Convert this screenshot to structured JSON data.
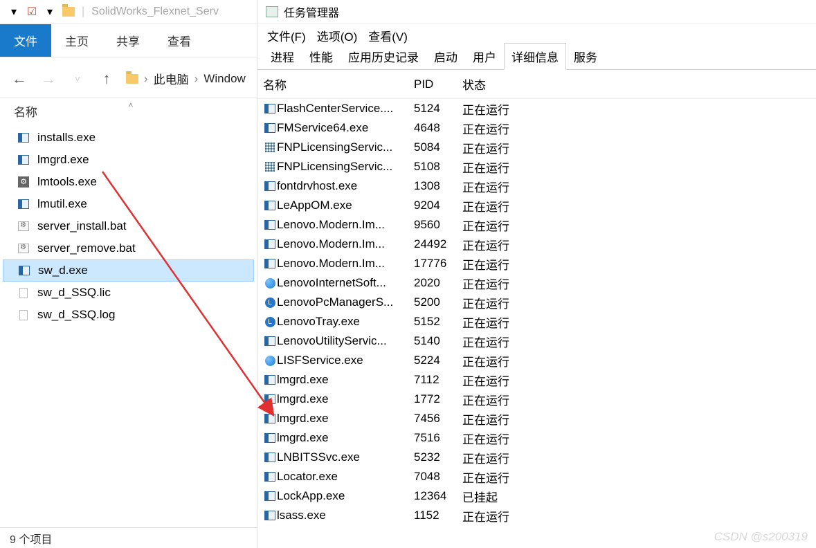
{
  "explorer": {
    "title_text": "SolidWorks_Flexnet_Serv",
    "ribbon": {
      "file": "文件",
      "home": "主页",
      "share": "共享",
      "view": "查看"
    },
    "breadcrumb": {
      "pc": "此电脑",
      "path2": "Window"
    },
    "column_header": "名称",
    "files": [
      {
        "name": "installs.exe",
        "icon": "app"
      },
      {
        "name": "lmgrd.exe",
        "icon": "app"
      },
      {
        "name": "lmtools.exe",
        "icon": "gear"
      },
      {
        "name": "lmutil.exe",
        "icon": "app"
      },
      {
        "name": "server_install.bat",
        "icon": "bat"
      },
      {
        "name": "server_remove.bat",
        "icon": "bat"
      },
      {
        "name": "sw_d.exe",
        "icon": "app",
        "selected": true
      },
      {
        "name": "sw_d_SSQ.lic",
        "icon": "doc"
      },
      {
        "name": "sw_d_SSQ.log",
        "icon": "doc"
      }
    ],
    "status": "9 个项目"
  },
  "taskmgr": {
    "title": "任务管理器",
    "menu": {
      "file": "文件(F)",
      "options": "选项(O)",
      "view": "查看(V)"
    },
    "tabs": {
      "processes": "进程",
      "performance": "性能",
      "app_history": "应用历史记录",
      "startup": "启动",
      "users": "用户",
      "details": "详细信息",
      "services": "服务"
    },
    "active_tab": "details",
    "columns": {
      "name": "名称",
      "pid": "PID",
      "status": "状态"
    },
    "processes": [
      {
        "name": "FlashCenterService....",
        "pid": "5124",
        "status": "正在运行",
        "icon": "app"
      },
      {
        "name": "FMService64.exe",
        "pid": "4648",
        "status": "正在运行",
        "icon": "app"
      },
      {
        "name": "FNPLicensingServic...",
        "pid": "5084",
        "status": "正在运行",
        "icon": "grid"
      },
      {
        "name": "FNPLicensingServic...",
        "pid": "5108",
        "status": "正在运行",
        "icon": "grid"
      },
      {
        "name": "fontdrvhost.exe",
        "pid": "1308",
        "status": "正在运行",
        "icon": "app"
      },
      {
        "name": "LeAppOM.exe",
        "pid": "9204",
        "status": "正在运行",
        "icon": "app"
      },
      {
        "name": "Lenovo.Modern.Im...",
        "pid": "9560",
        "status": "正在运行",
        "icon": "app"
      },
      {
        "name": "Lenovo.Modern.Im...",
        "pid": "24492",
        "status": "正在运行",
        "icon": "app"
      },
      {
        "name": "Lenovo.Modern.Im...",
        "pid": "17776",
        "status": "正在运行",
        "icon": "app"
      },
      {
        "name": "LenovoInternetSoft...",
        "pid": "2020",
        "status": "正在运行",
        "icon": "circleblue"
      },
      {
        "name": "LenovoPcManagerS...",
        "pid": "5200",
        "status": "正在运行",
        "icon": "L"
      },
      {
        "name": "LenovoTray.exe",
        "pid": "5152",
        "status": "正在运行",
        "icon": "L"
      },
      {
        "name": "LenovoUtilityServic...",
        "pid": "5140",
        "status": "正在运行",
        "icon": "app"
      },
      {
        "name": "LISFService.exe",
        "pid": "5224",
        "status": "正在运行",
        "icon": "circleblue"
      },
      {
        "name": "lmgrd.exe",
        "pid": "7112",
        "status": "正在运行",
        "icon": "app"
      },
      {
        "name": "lmgrd.exe",
        "pid": "1772",
        "status": "正在运行",
        "icon": "app"
      },
      {
        "name": "lmgrd.exe",
        "pid": "7456",
        "status": "正在运行",
        "icon": "app"
      },
      {
        "name": "lmgrd.exe",
        "pid": "7516",
        "status": "正在运行",
        "icon": "app"
      },
      {
        "name": "LNBITSSvc.exe",
        "pid": "5232",
        "status": "正在运行",
        "icon": "app"
      },
      {
        "name": "Locator.exe",
        "pid": "7048",
        "status": "正在运行",
        "icon": "app"
      },
      {
        "name": "LockApp.exe",
        "pid": "12364",
        "status": "已挂起",
        "icon": "app"
      },
      {
        "name": "lsass.exe",
        "pid": "1152",
        "status": "正在运行",
        "icon": "app"
      }
    ]
  },
  "watermark": "CSDN @s200319"
}
